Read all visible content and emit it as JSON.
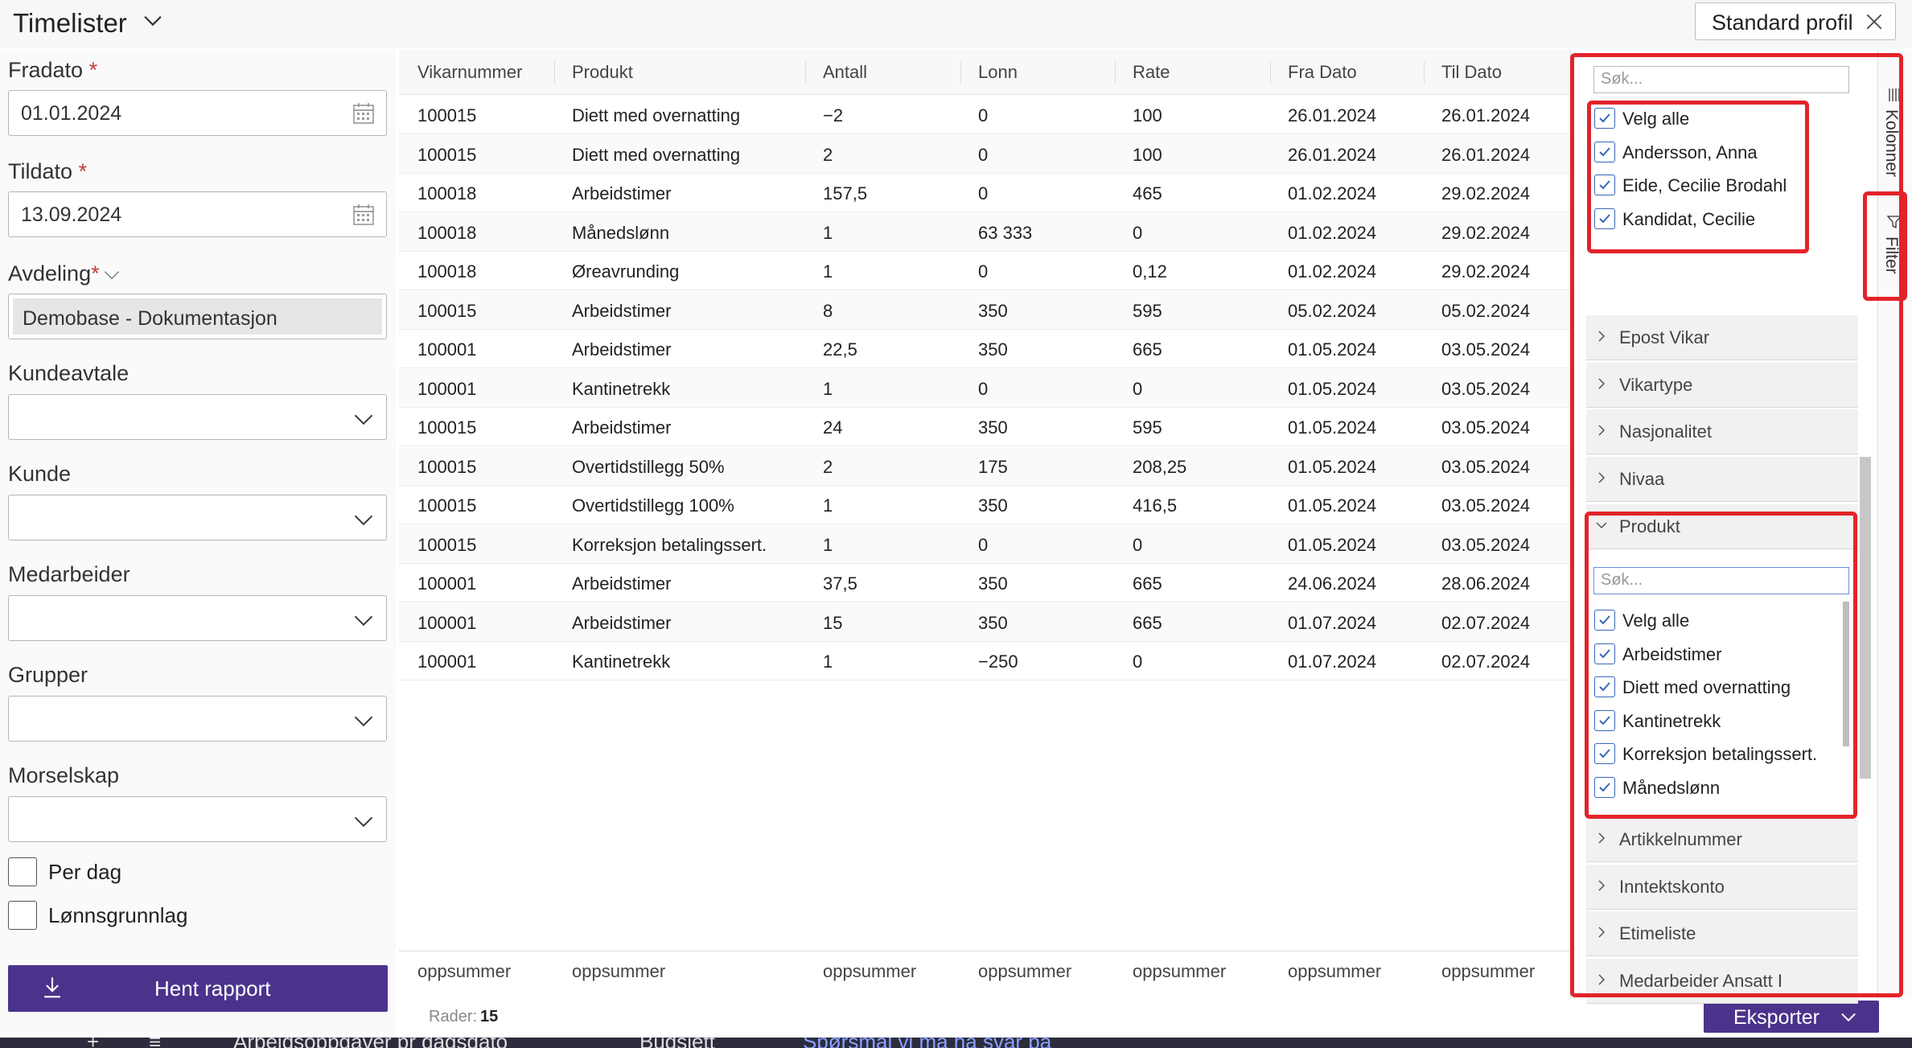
{
  "header": {
    "title": "Timelister",
    "profile_label": "Standard profil"
  },
  "form": {
    "fradato": {
      "label": "Fradato",
      "required_mark": "*",
      "value": "01.01.2024"
    },
    "tildato": {
      "label": "Tildato",
      "required_mark": "*",
      "value": "13.09.2024"
    },
    "avdeling": {
      "label": "Avdeling",
      "required_mark": "*",
      "value": "Demobase - Dokumentasjon"
    },
    "kundeavtale": {
      "label": "Kundeavtale",
      "value": ""
    },
    "kunde": {
      "label": "Kunde",
      "value": ""
    },
    "medarbeider": {
      "label": "Medarbeider",
      "value": ""
    },
    "grupper": {
      "label": "Grupper",
      "value": ""
    },
    "morselskap": {
      "label": "Morselskap",
      "value": ""
    },
    "per_dag": {
      "label": "Per dag",
      "checked": false
    },
    "lonnsgrunnlag": {
      "label": "Lønnsgrunnlag",
      "checked": false
    },
    "hent_label": "Hent rapport"
  },
  "grid": {
    "columns": [
      "Vikarnummer",
      "Produkt",
      "Antall",
      "Lonn",
      "Rate",
      "Fra Dato",
      "Til Dato"
    ],
    "rows": [
      [
        "100015",
        "Diett med overnatting",
        "−2",
        "0",
        "100",
        "26.01.2024",
        "26.01.2024"
      ],
      [
        "100015",
        "Diett med overnatting",
        "2",
        "0",
        "100",
        "26.01.2024",
        "26.01.2024"
      ],
      [
        "100018",
        "Arbeidstimer",
        "157,5",
        "0",
        "465",
        "01.02.2024",
        "29.02.2024"
      ],
      [
        "100018",
        "Månedslønn",
        "1",
        "63 333",
        "0",
        "01.02.2024",
        "29.02.2024"
      ],
      [
        "100018",
        "Øreavrunding",
        "1",
        "0",
        "0,12",
        "01.02.2024",
        "29.02.2024"
      ],
      [
        "100015",
        "Arbeidstimer",
        "8",
        "350",
        "595",
        "05.02.2024",
        "05.02.2024"
      ],
      [
        "100001",
        "Arbeidstimer",
        "22,5",
        "350",
        "665",
        "01.05.2024",
        "03.05.2024"
      ],
      [
        "100001",
        "Kantinetrekk",
        "1",
        "0",
        "0",
        "01.05.2024",
        "03.05.2024"
      ],
      [
        "100015",
        "Arbeidstimer",
        "24",
        "350",
        "595",
        "01.05.2024",
        "03.05.2024"
      ],
      [
        "100015",
        "Overtidstillegg 50%",
        "2",
        "175",
        "208,25",
        "01.05.2024",
        "03.05.2024"
      ],
      [
        "100015",
        "Overtidstillegg 100%",
        "1",
        "350",
        "416,5",
        "01.05.2024",
        "03.05.2024"
      ],
      [
        "100015",
        "Korreksjon betalingssert.",
        "1",
        "0",
        "0",
        "01.05.2024",
        "03.05.2024"
      ],
      [
        "100001",
        "Arbeidstimer",
        "37,5",
        "350",
        "665",
        "24.06.2024",
        "28.06.2024"
      ],
      [
        "100001",
        "Arbeidstimer",
        "15",
        "350",
        "665",
        "01.07.2024",
        "02.07.2024"
      ],
      [
        "100001",
        "Kantinetrekk",
        "1",
        "−250",
        "0",
        "01.07.2024",
        "02.07.2024"
      ]
    ],
    "footer_label": "oppsummer",
    "rows_label": "Rader:",
    "rows_count": "15",
    "export_label": "Eksporter"
  },
  "filter_panel": {
    "search_placeholder": "Søk...",
    "employee_options": [
      {
        "label": "Velg alle",
        "checked": true
      },
      {
        "label": "Andersson, Anna",
        "checked": true
      },
      {
        "label": "Eide, Cecilie Brodahl",
        "checked": true
      },
      {
        "label": "Kandidat, Cecilie",
        "checked": true
      }
    ],
    "sections_top": [
      "Epost Vikar",
      "Vikartype",
      "Nasjonalitet",
      "Nivaa"
    ],
    "produkt": {
      "label": "Produkt",
      "search_placeholder": "Søk...",
      "options": [
        {
          "label": "Velg alle",
          "checked": true
        },
        {
          "label": "Arbeidstimer",
          "checked": true
        },
        {
          "label": "Diett med overnatting",
          "checked": true
        },
        {
          "label": "Kantinetrekk",
          "checked": true
        },
        {
          "label": "Korreksjon betalingssert.",
          "checked": true
        },
        {
          "label": "Månedslønn",
          "checked": true
        }
      ]
    },
    "sections_bottom": [
      "Artikkelnummer",
      "Inntektskonto",
      "Etimeliste",
      "Medarbeider Ansatt I"
    ]
  },
  "side_tabs": {
    "kolonner": "Kolonner",
    "filter": "Filter"
  },
  "bottom_tabs": [
    "Arbeidsoppgaver pr dagsdato",
    "Budsjett",
    "Spørsmål vi må ha svar på"
  ],
  "colors": {
    "accent": "#4b338c",
    "highlight": "#e3232a",
    "checkbox": "#3a66b8"
  }
}
